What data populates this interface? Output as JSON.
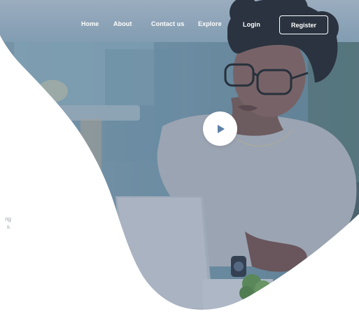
{
  "nav": {
    "items": [
      {
        "label": "Home"
      },
      {
        "label": "About"
      },
      {
        "label": "Contact us"
      },
      {
        "label": "Explore"
      },
      {
        "label": "Login"
      }
    ],
    "register_label": "Register"
  },
  "hero": {
    "description_lines": [
      "ng",
      "s."
    ]
  },
  "colors": {
    "hero_tint": "#6e84a0",
    "wall": "#7f9db0",
    "shirt": "#a7acb5",
    "skin": "#7a5a57",
    "text_muted": "#9aa3ab",
    "play_icon": "#5d7fa6"
  },
  "icons": {
    "play": "play-icon"
  }
}
